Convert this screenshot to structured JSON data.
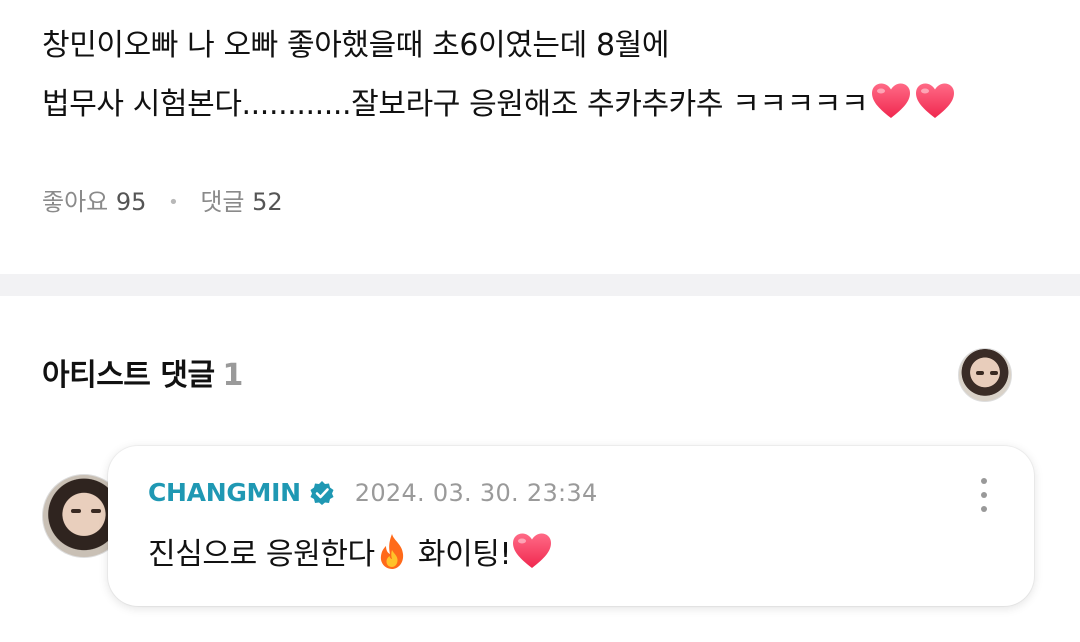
{
  "post": {
    "line1": "창민이오빠 나 오빠 좋아했을때 초6이였는데 8월에",
    "line2": "법무사 시험본다............잘보라구 응원해조 추카추카추 ㅋㅋㅋㅋㅋ",
    "line2_emojis": [
      "heart-icon",
      "heart-icon"
    ],
    "likes_label": "좋아요",
    "likes_count": "95",
    "comments_label": "댓글",
    "comments_count": "52"
  },
  "artist_comments": {
    "title": "아티스트 댓글",
    "count": "1",
    "comment": {
      "author": "CHANGMIN",
      "verified_icon": "verified-badge-icon",
      "timestamp": "2024. 03. 30. 23:34",
      "text_before": "진심으로 응원한다",
      "text_after": " 화이팅!",
      "emojis": [
        "fire-icon",
        "heart-icon"
      ]
    }
  },
  "colors": {
    "author": "#1f98b3",
    "meta": "#8a8a8a",
    "divider": "#f2f2f4",
    "heart": "#ff3b5c"
  }
}
